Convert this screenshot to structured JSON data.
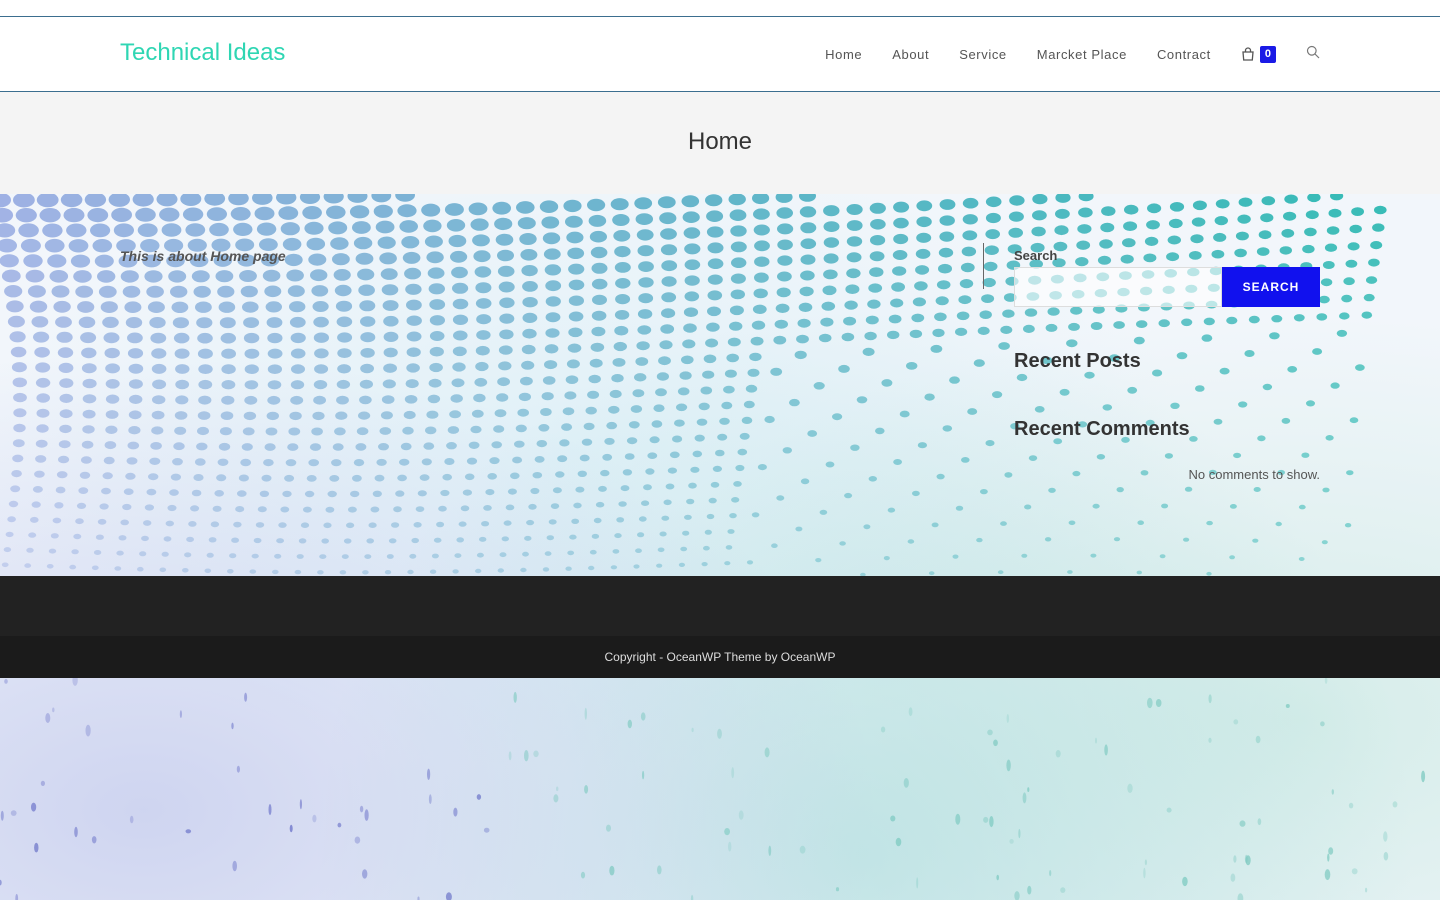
{
  "site": {
    "title": "Technical Ideas"
  },
  "nav": {
    "items": [
      {
        "label": "Home"
      },
      {
        "label": "About"
      },
      {
        "label": "Service"
      },
      {
        "label": "Marcket Place"
      },
      {
        "label": "Contract"
      }
    ],
    "cart_count": "0",
    "cart_icon": "shopping-bag-icon",
    "search_icon": "search-icon"
  },
  "page": {
    "title": "Home",
    "content": "This is about Home page"
  },
  "sidebar": {
    "search_label": "Search",
    "search_button": "SEARCH",
    "search_value": "",
    "recent_posts_title": "Recent Posts",
    "recent_comments_title": "Recent Comments",
    "no_comments": "No comments to show."
  },
  "footer": {
    "copyright": "Copyright - OceanWP Theme by OceanWP"
  },
  "colors": {
    "site_title": "#2fd6b3",
    "accent": "#1111ee",
    "footer_dark": "#222222",
    "footer_bottom": "#1b1b1b",
    "page_header_bg": "#f4f4f4"
  }
}
